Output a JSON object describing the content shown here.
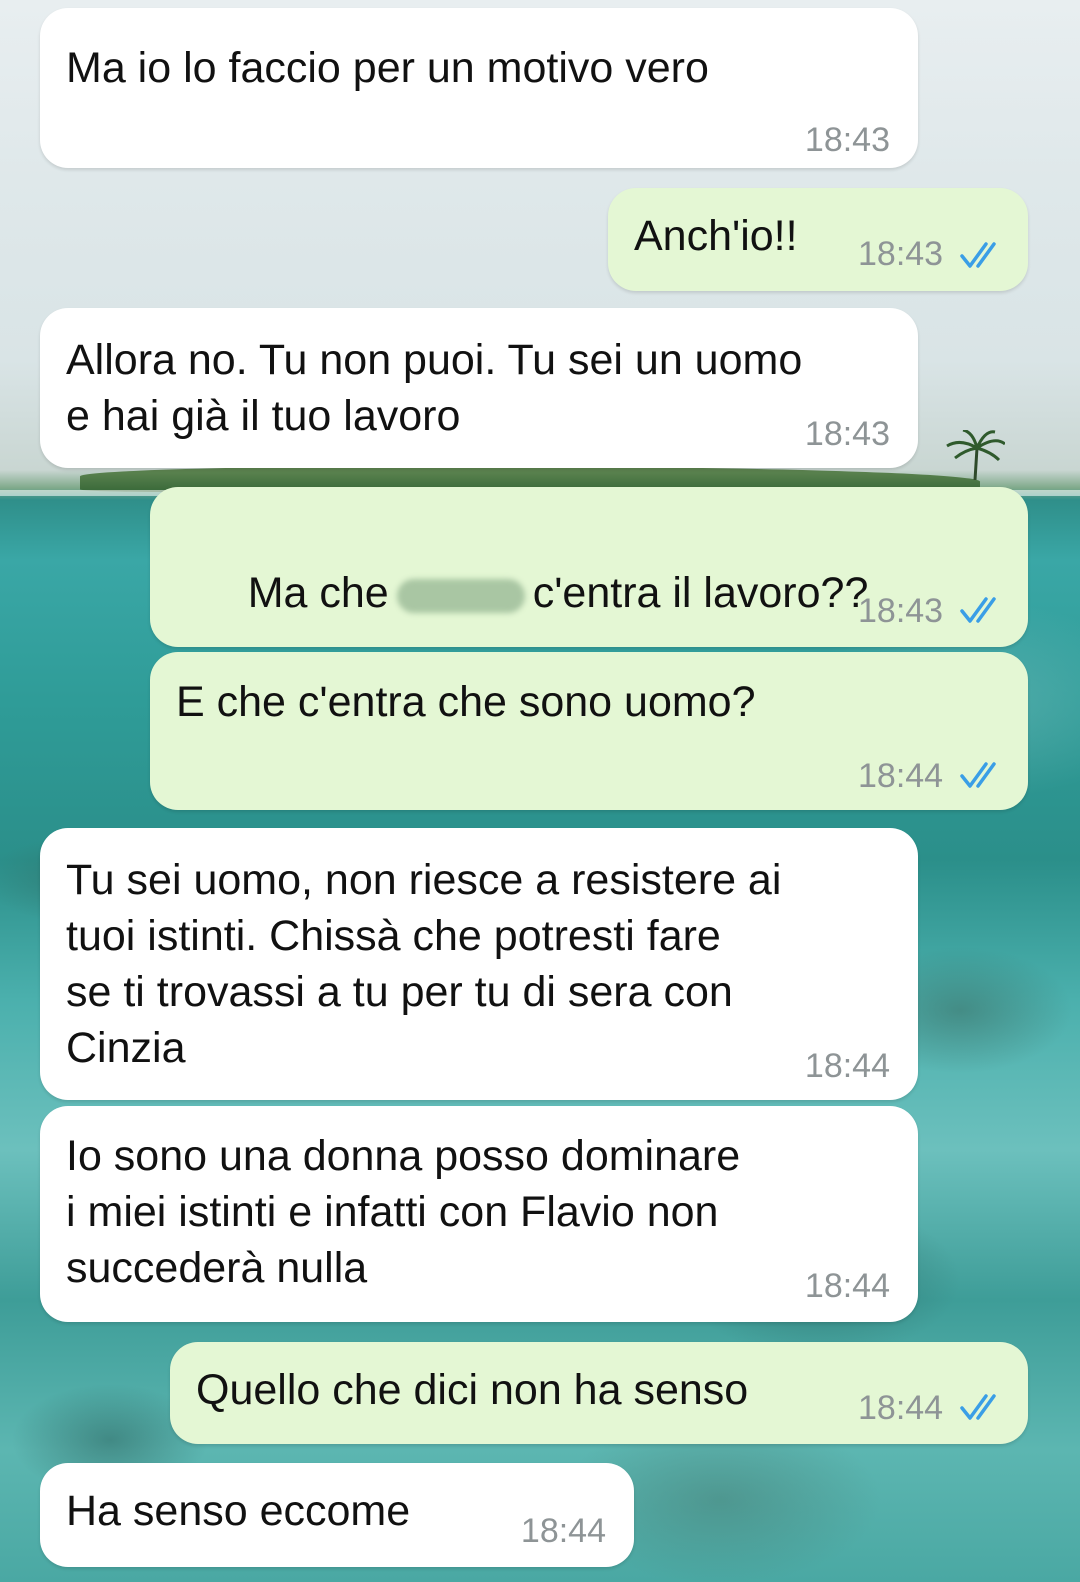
{
  "colors": {
    "incoming_bubble": "#ffffff",
    "outgoing_bubble": "#e4f7d4",
    "timestamp": "#8e9496",
    "read_ticks": "#3a9ee6"
  },
  "icons": {
    "read_receipt": "double-check-icon",
    "redaction": "redacted-word"
  },
  "messages": [
    {
      "direction": "incoming",
      "text": "Ma io lo faccio per un motivo vero",
      "time": "18:43"
    },
    {
      "direction": "outgoing",
      "text": "Anch'io!!",
      "time": "18:43",
      "status": "read"
    },
    {
      "direction": "incoming",
      "text": "Allora no. Tu non puoi. Tu sei un uomo\ne hai già il tuo lavoro",
      "time": "18:43"
    },
    {
      "direction": "outgoing",
      "text_before": "Ma che",
      "text_after": "c'entra il lavoro??",
      "time": "18:43",
      "status": "read"
    },
    {
      "direction": "outgoing",
      "text": "E che c'entra che sono uomo?",
      "time": "18:44",
      "status": "read"
    },
    {
      "direction": "incoming",
      "text": "Tu sei uomo, non riesce a resistere ai\ntuoi istinti. Chissà che potresti fare\nse ti trovassi a tu per tu di sera con\nCinzia",
      "time": "18:44"
    },
    {
      "direction": "incoming",
      "text": "Io sono una donna posso dominare\ni miei istinti e infatti con Flavio non\nsuccederà nulla",
      "time": "18:44"
    },
    {
      "direction": "outgoing",
      "text": "Quello che dici non ha senso",
      "time": "18:44",
      "status": "read"
    },
    {
      "direction": "incoming",
      "text": "Ha senso eccome",
      "time": "18:44"
    }
  ]
}
